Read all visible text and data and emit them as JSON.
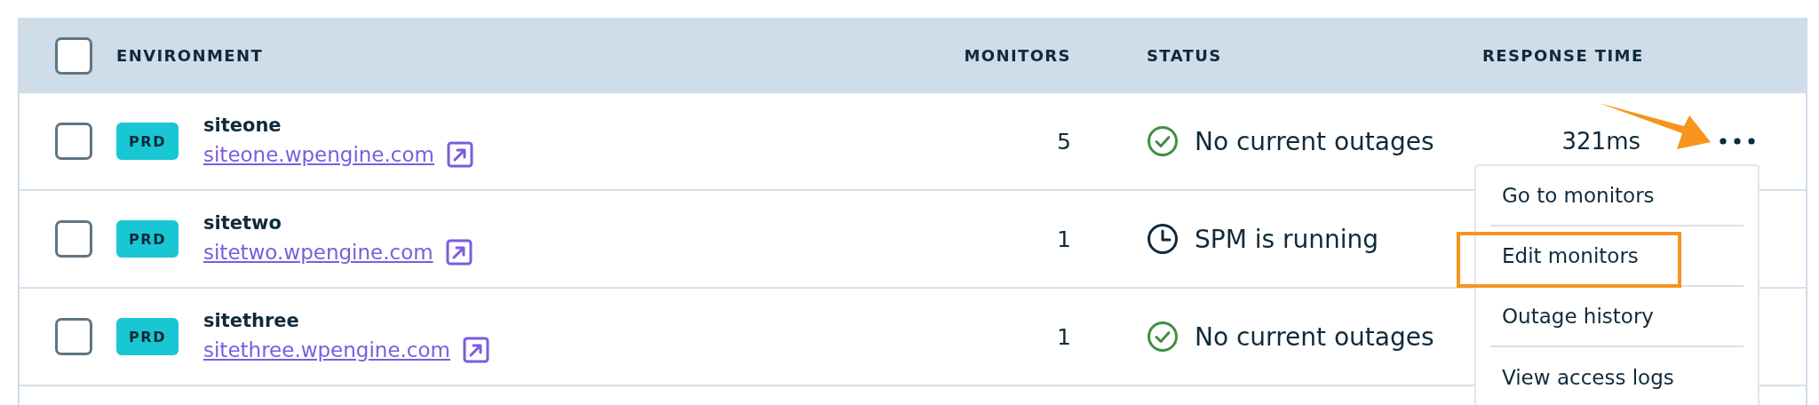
{
  "table": {
    "columns": [
      {
        "label": "ENVIRONMENT"
      },
      {
        "label": "MONITORS"
      },
      {
        "label": "STATUS"
      },
      {
        "label": "RESPONSE TIME"
      }
    ],
    "select_all": {
      "checked": false
    },
    "rows": [
      {
        "checked": false,
        "badge": "PRD",
        "name": "siteone",
        "url": "siteone.wpengine.com",
        "monitors": "5",
        "status": {
          "kind": "ok",
          "text": "No current outages"
        },
        "response_time": "321ms",
        "actions": true
      },
      {
        "checked": false,
        "badge": "PRD",
        "name": "sitetwo",
        "url": "sitetwo.wpengine.com",
        "monitors": "1",
        "status": {
          "kind": "running",
          "text": "SPM is running"
        },
        "actions": false
      },
      {
        "checked": false,
        "badge": "PRD",
        "name": "sitethree",
        "url": "sitethree.wpengine.com",
        "monitors": "1",
        "status": {
          "kind": "ok",
          "text": "No current outages"
        },
        "actions": false
      }
    ]
  },
  "row_menu": {
    "items": [
      {
        "label": "Go to monitors",
        "highlighted": false
      },
      {
        "label": "Edit monitors",
        "highlighted": true
      },
      {
        "label": "Outage history",
        "highlighted": false
      },
      {
        "label": "View access logs",
        "highlighted": false
      }
    ]
  },
  "annotations": [
    {
      "kind": "arrow"
    }
  ]
}
